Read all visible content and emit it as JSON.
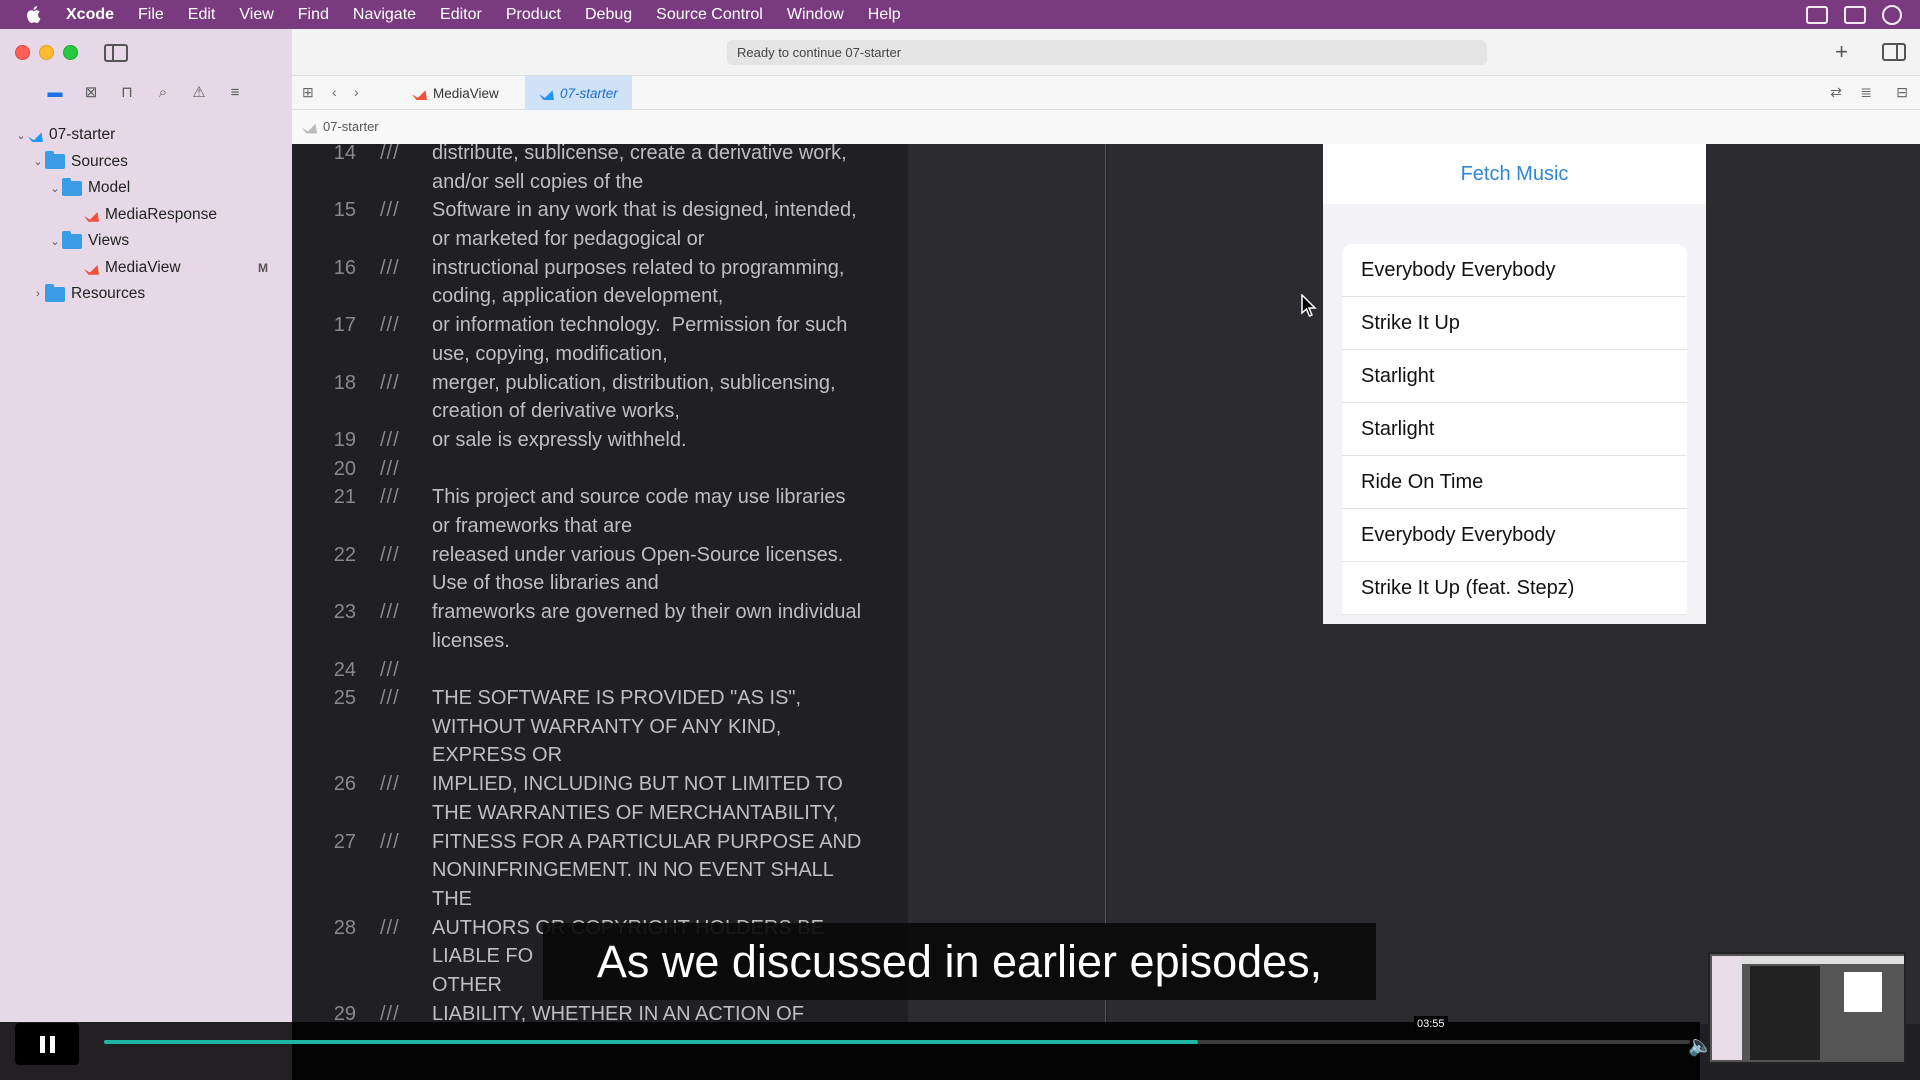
{
  "menubar": {
    "app": "Xcode",
    "items": [
      "File",
      "Edit",
      "View",
      "Find",
      "Navigate",
      "Editor",
      "Product",
      "Debug",
      "Source Control",
      "Window",
      "Help"
    ]
  },
  "toolbar": {
    "activity": "Ready to continue 07-starter"
  },
  "tabs": [
    {
      "label": "MediaView",
      "active": false
    },
    {
      "label": "07-starter",
      "active": true
    }
  ],
  "jumpbar": {
    "crumb": "07-starter"
  },
  "navigator": {
    "tree": [
      {
        "label": "07-starter",
        "kind": "project"
      },
      {
        "label": "Sources",
        "kind": "folder"
      },
      {
        "label": "Model",
        "kind": "folder"
      },
      {
        "label": "MediaResponse",
        "kind": "swift"
      },
      {
        "label": "Views",
        "kind": "folder"
      },
      {
        "label": "MediaView",
        "kind": "swift",
        "badge": "M"
      },
      {
        "label": "Resources",
        "kind": "folder"
      }
    ]
  },
  "editor": {
    "lines": [
      {
        "num": "14",
        "text": "distribute, sublicense, create a derivative work,\nand/or sell copies of the"
      },
      {
        "num": "15",
        "text": "Software in any work that is designed, intended,\nor marketed for pedagogical or"
      },
      {
        "num": "16",
        "text": "instructional purposes related to programming,\ncoding, application development,"
      },
      {
        "num": "17",
        "text": "or information technology.  Permission for such\nuse, copying, modification,"
      },
      {
        "num": "18",
        "text": "merger, publication, distribution, sublicensing,\ncreation of derivative works,"
      },
      {
        "num": "19",
        "text": "or sale is expressly withheld."
      },
      {
        "num": "20",
        "text": ""
      },
      {
        "num": "21",
        "text": "This project and source code may use libraries\nor frameworks that are"
      },
      {
        "num": "22",
        "text": "released under various Open-Source licenses.\nUse of those libraries and"
      },
      {
        "num": "23",
        "text": "frameworks are governed by their own individual\nlicenses."
      },
      {
        "num": "24",
        "text": ""
      },
      {
        "num": "25",
        "text": "THE SOFTWARE IS PROVIDED \"AS IS\",\nWITHOUT WARRANTY OF ANY KIND,\nEXPRESS OR"
      },
      {
        "num": "26",
        "text": "IMPLIED, INCLUDING BUT NOT LIMITED TO\nTHE WARRANTIES OF MERCHANTABILITY,"
      },
      {
        "num": "27",
        "text": "FITNESS FOR A PARTICULAR PURPOSE AND\nNONINFRINGEMENT. IN NO EVENT SHALL\nTHE"
      },
      {
        "num": "28",
        "text": "AUTHORS OR COPYRIGHT HOLDERS BE\nLIABLE FO\nOTHER"
      },
      {
        "num": "29",
        "text": "LIABILITY, WHETHER IN AN ACTION OF"
      }
    ]
  },
  "preview": {
    "title": "Fetch Music",
    "tracks": [
      "Everybody Everybody",
      "Strike It Up",
      "Starlight",
      "Starlight",
      "Ride On Time",
      "Everybody Everybody",
      "Strike It Up (feat. Stepz)"
    ]
  },
  "player": {
    "subtitle": "As we discussed in earlier episodes,",
    "time": "03:55",
    "progress": 0.69
  },
  "colors": {
    "menubar": "#7a3a7f",
    "sidebar": "#e6d8e6",
    "accent": "#2f86d8"
  }
}
